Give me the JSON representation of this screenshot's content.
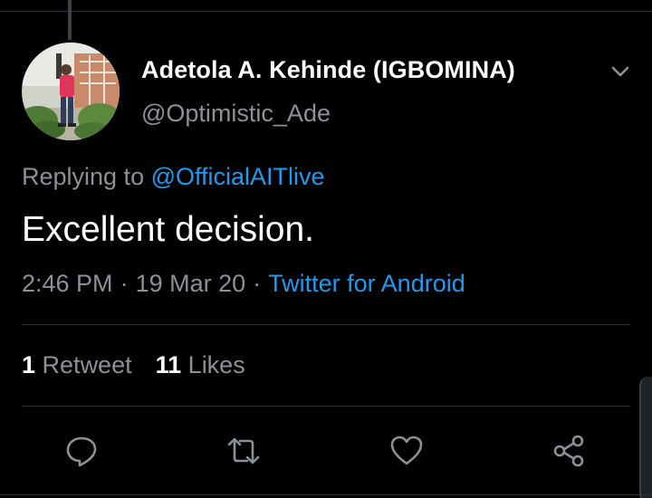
{
  "tweet": {
    "author": {
      "display_name": "Adetola A. Kehinde (IGBOMINA)",
      "handle": "@Optimistic_Ade"
    },
    "replying_to_label": "Replying to",
    "replying_to_handle": "@OfficialAITlive",
    "text": "Excellent decision.",
    "time": "2:46 PM",
    "separator": "·",
    "date": "19 Mar 20",
    "source": "Twitter for Android"
  },
  "stats": {
    "retweets_count": "1",
    "retweets_label": "Retweet",
    "likes_count": "11",
    "likes_label": "Likes"
  },
  "icons": {
    "menu": "chevron-down-icon",
    "reply": "reply-icon",
    "retweet": "retweet-icon",
    "like": "heart-icon",
    "share": "share-icon"
  },
  "colors": {
    "background": "#000000",
    "primary_text": "#ffffff",
    "secondary_text": "#8b9197",
    "link": "#1d9bf0",
    "divider": "#2f3336"
  }
}
